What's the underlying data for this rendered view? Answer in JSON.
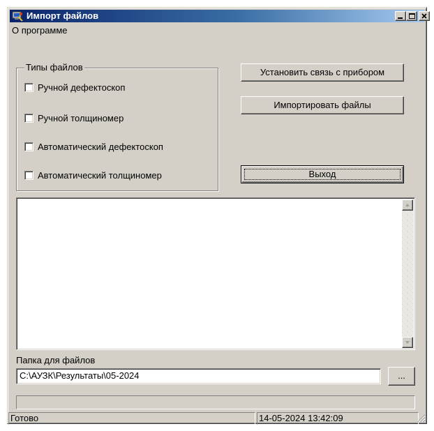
{
  "window": {
    "title": "Импорт файлов"
  },
  "menu": {
    "about": "О программе"
  },
  "file_types": {
    "legend": "Типы файлов",
    "options": [
      {
        "label": "Ручной дефектоскоп",
        "checked": false
      },
      {
        "label": "Ручной толщиномер",
        "checked": false
      },
      {
        "label": "Автоматический дефектоскоп",
        "checked": false
      },
      {
        "label": "Автоматический толщиномер",
        "checked": false
      }
    ]
  },
  "buttons": {
    "connect": "Установить связь с прибором",
    "import": "Импортировать файлы",
    "exit": "Выход",
    "browse": "..."
  },
  "folder": {
    "label": "Папка для файлов",
    "path": "C:\\АУЗК\\Результаты\\05-2024"
  },
  "progress": {
    "value": 0
  },
  "status": {
    "text": "Готово",
    "datetime": "14-05-2024 13:42:09"
  }
}
